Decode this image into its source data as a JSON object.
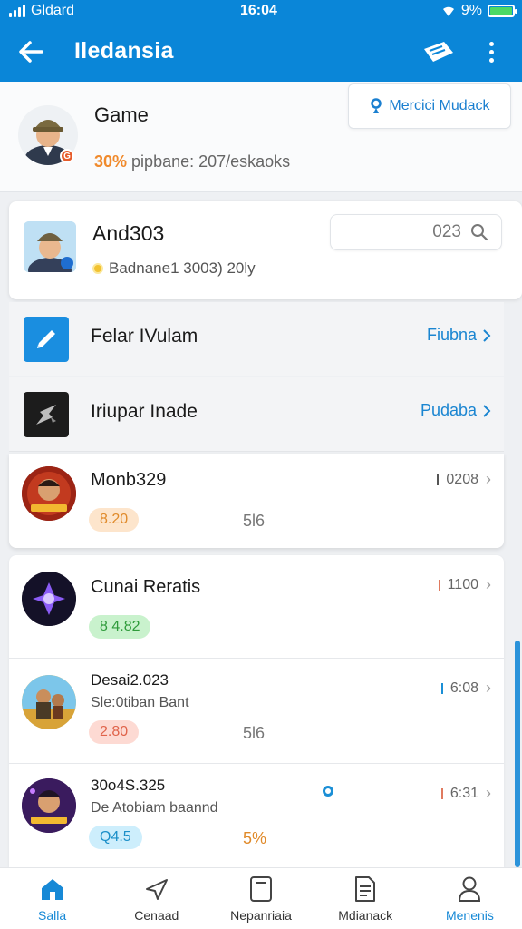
{
  "status_bar": {
    "carrier": "Gldard",
    "time": "16:04",
    "battery": "9%"
  },
  "app_bar": {
    "title": "Iledansia"
  },
  "profile": {
    "name": "Game",
    "badge": "G",
    "stats_pct": "30%",
    "stats_text": "pipbane: 207/eskaoks",
    "member_button": "Mercici Mudack"
  },
  "user_card": {
    "name": "And303",
    "sub": "Badnane1 3003) 20ly",
    "search_value": "023"
  },
  "quick_links": [
    {
      "label": "Felar IVulam",
      "action": "Fiubna",
      "icon": "pen-icon"
    },
    {
      "label": "Iriupar Inade",
      "action": "Pudaba",
      "icon": "shuriken-icon"
    }
  ],
  "games": [
    {
      "title": "Monb329",
      "sub": "",
      "pill": "8.20",
      "mid": "5l6",
      "right": "0208",
      "mark": "#555"
    },
    {
      "title": "Cunai Reratis",
      "sub": "",
      "pill": "8 4.82",
      "mid": "",
      "right": "1100",
      "mark": "#e07a5f"
    },
    {
      "title": "Desai2.023",
      "sub": "Sle:0tiban Bant",
      "pill": "2.80",
      "mid": "5l6",
      "right": "6:08",
      "mark": "#1b8fd6"
    },
    {
      "title": "30o4S.325",
      "sub": "De Atobiam baannd",
      "pill": "Q4.5",
      "mid": "5%",
      "right": "6:31",
      "mark": "#e07a5f"
    }
  ],
  "bottom_nav": [
    {
      "label": "Salla",
      "icon": "home-icon"
    },
    {
      "label": "Cenaad",
      "icon": "send-icon"
    },
    {
      "label": "Nepanriaia",
      "icon": "card-icon"
    },
    {
      "label": "Mdianack",
      "icon": "document-icon"
    },
    {
      "label": "Menenis",
      "icon": "profile-icon"
    }
  ],
  "colors": {
    "primary": "#0a86d8",
    "accent": "#1789d6"
  }
}
